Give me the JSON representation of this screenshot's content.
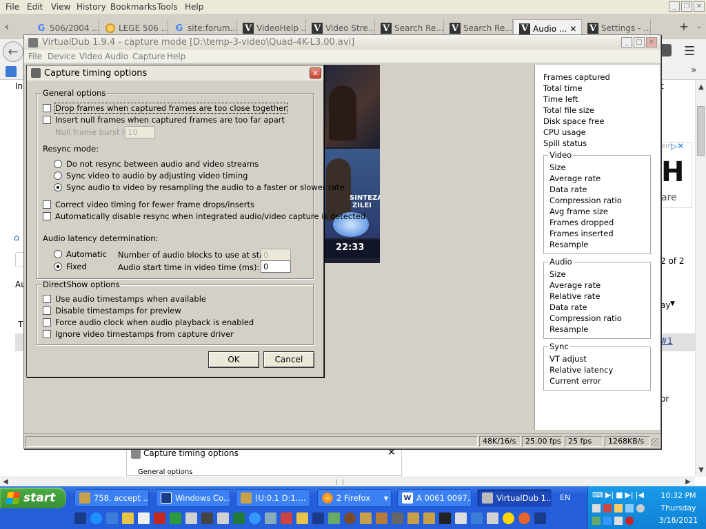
{
  "firefox": {
    "menu": [
      "File",
      "Edit",
      "View",
      "History",
      "Bookmarks",
      "Tools",
      "Help"
    ],
    "tabs": [
      {
        "label": "506/2004 ...",
        "icon": "google-icon"
      },
      {
        "label": "LEGE 506 ...",
        "icon": "lege-icon"
      },
      {
        "label": "site:forum...",
        "icon": "google-icon"
      },
      {
        "label": "VideoHelp ...",
        "icon": "videohelp-icon"
      },
      {
        "label": "Video Stre...",
        "icon": "videohelp-icon"
      },
      {
        "label": "Search Re...",
        "icon": "videohelp-icon"
      },
      {
        "label": "Search Re...",
        "icon": "videohelp-icon"
      },
      {
        "label": "Audio ...",
        "icon": "videohelp-icon",
        "active": true
      },
      {
        "label": "Settings - ...",
        "icon": "videohelp-icon"
      }
    ]
  },
  "webpage": {
    "fragments": {
      "in": "In",
      "t": "t",
      "au": "Au",
      "ti": "T",
      "pager": "2 of 2",
      "ay": "ay",
      "link1": "#1",
      "or": "or",
      "ad": "H",
      "adbottom": "are",
      "adsmall": "em"
    }
  },
  "virtualdub": {
    "title": "VirtualDub 1.9.4 - capture mode [D:\\temp-3-video\\Quad-4K-L3.00.avi]",
    "menu": [
      "File",
      "Device",
      "Video",
      "Audio",
      "Capture",
      "Help"
    ],
    "preview": {
      "caption1": "SINTEZA",
      "caption2": "ZILEI",
      "time": "22:33"
    },
    "stats": [
      "Frames captured",
      "Total time",
      "Time left",
      "Total file size",
      "Disk space free",
      "CPU usage",
      "Spill status"
    ],
    "video_group": {
      "label": "Video",
      "items": [
        "Size",
        "Average rate",
        "Data rate",
        "Compression ratio",
        "Avg frame size",
        "Frames dropped",
        "Frames inserted",
        "Resample"
      ]
    },
    "audio_group": {
      "label": "Audio",
      "items": [
        "Size",
        "Average rate",
        "Relative rate",
        "Data rate",
        "Compression ratio",
        "Resample"
      ]
    },
    "sync_group": {
      "label": "Sync",
      "items": [
        "VT adjust",
        "Relative latency",
        "Current error"
      ]
    },
    "status": [
      "48K/16/s",
      "25.00 fps",
      "25 fps",
      "1268KB/s"
    ]
  },
  "dialog": {
    "title": "Capture timing options",
    "general": {
      "label": "General options",
      "drop_frames": "Drop frames when captured frames are too close together",
      "insert_null": "Insert null frames when captured frames are too far apart",
      "null_burst_label": "Null frame burst limit:",
      "null_burst_value": "10",
      "resync_label": "Resync mode:",
      "resync_none": "Do not resync between audio and video streams",
      "resync_video": "Sync video to audio by adjusting video timing",
      "resync_audio": "Sync audio to video by resampling the audio to a faster or slower rate",
      "correct_timing": "Correct video timing for fewer frame drops/inserts",
      "auto_disable": "Automatically disable resync when integrated audio/video capture is detected",
      "latency_label": "Audio latency determination:",
      "latency_auto": "Automatic",
      "latency_fixed": "Fixed",
      "blocks_label": "Number of audio blocks to use at start:",
      "blocks_value": "0",
      "start_time_label": "Audio start time in video time (ms):",
      "start_time_value": "0"
    },
    "directshow": {
      "label": "DirectShow options",
      "use_timestamps": "Use audio timestamps when available",
      "disable_preview": "Disable timestamps for preview",
      "force_clock": "Force audio clock when audio playback is enabled",
      "ignore_video": "Ignore video timestamps from capture driver"
    },
    "ok": "OK",
    "cancel": "Cancel"
  },
  "ghost_dialog": {
    "title": "Capture timing options",
    "general": "General options"
  },
  "taskbar": {
    "start": "start",
    "buttons": [
      {
        "label": "758. accept ...",
        "icon": "tool-icon"
      },
      {
        "label": "Windows Co...",
        "icon": "floppy-icon"
      },
      {
        "label": "(U:0.1 D:1....",
        "icon": "tool-icon"
      },
      {
        "label": "2 Firefox",
        "icon": "firefox-icon"
      },
      {
        "label": "A 0061 0097...",
        "icon": "word-icon"
      },
      {
        "label": "VirtualDub 1...",
        "icon": "virtualdub-icon",
        "active": true
      }
    ],
    "lang": "EN",
    "clock": {
      "time": "10:32 PM",
      "day": "Thursday",
      "date": "3/18/2021"
    }
  }
}
